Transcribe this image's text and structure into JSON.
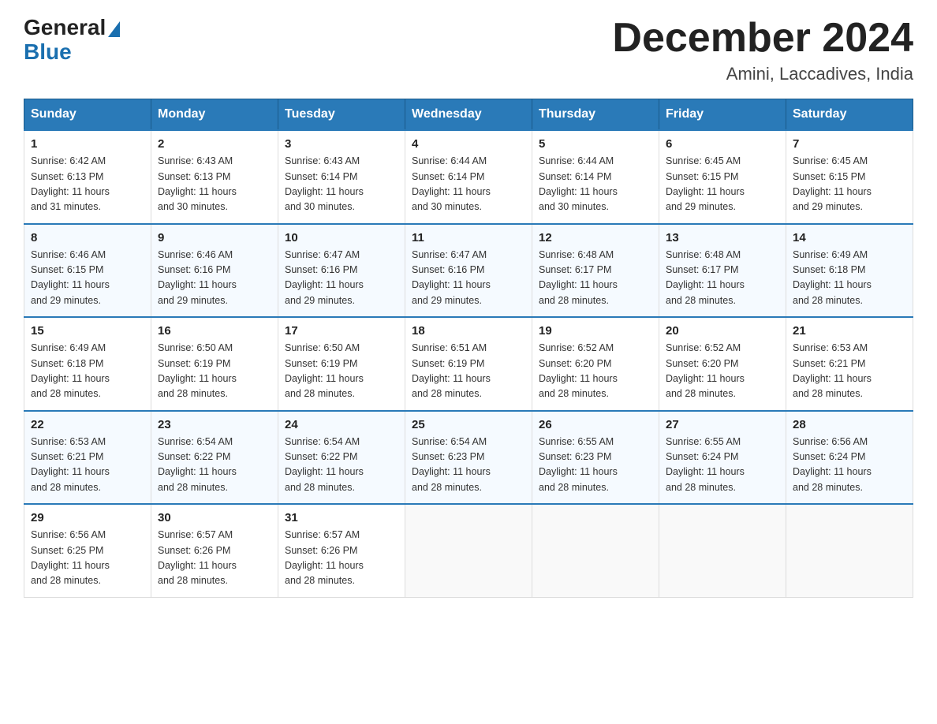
{
  "header": {
    "logo_line1": "General",
    "logo_line2": "Blue",
    "title": "December 2024",
    "subtitle": "Amini, Laccadives, India"
  },
  "days_of_week": [
    "Sunday",
    "Monday",
    "Tuesday",
    "Wednesday",
    "Thursday",
    "Friday",
    "Saturday"
  ],
  "weeks": [
    [
      {
        "day": "1",
        "sunrise": "6:42 AM",
        "sunset": "6:13 PM",
        "daylight": "11 hours and 31 minutes."
      },
      {
        "day": "2",
        "sunrise": "6:43 AM",
        "sunset": "6:13 PM",
        "daylight": "11 hours and 30 minutes."
      },
      {
        "day": "3",
        "sunrise": "6:43 AM",
        "sunset": "6:14 PM",
        "daylight": "11 hours and 30 minutes."
      },
      {
        "day": "4",
        "sunrise": "6:44 AM",
        "sunset": "6:14 PM",
        "daylight": "11 hours and 30 minutes."
      },
      {
        "day": "5",
        "sunrise": "6:44 AM",
        "sunset": "6:14 PM",
        "daylight": "11 hours and 30 minutes."
      },
      {
        "day": "6",
        "sunrise": "6:45 AM",
        "sunset": "6:15 PM",
        "daylight": "11 hours and 29 minutes."
      },
      {
        "day": "7",
        "sunrise": "6:45 AM",
        "sunset": "6:15 PM",
        "daylight": "11 hours and 29 minutes."
      }
    ],
    [
      {
        "day": "8",
        "sunrise": "6:46 AM",
        "sunset": "6:15 PM",
        "daylight": "11 hours and 29 minutes."
      },
      {
        "day": "9",
        "sunrise": "6:46 AM",
        "sunset": "6:16 PM",
        "daylight": "11 hours and 29 minutes."
      },
      {
        "day": "10",
        "sunrise": "6:47 AM",
        "sunset": "6:16 PM",
        "daylight": "11 hours and 29 minutes."
      },
      {
        "day": "11",
        "sunrise": "6:47 AM",
        "sunset": "6:16 PM",
        "daylight": "11 hours and 29 minutes."
      },
      {
        "day": "12",
        "sunrise": "6:48 AM",
        "sunset": "6:17 PM",
        "daylight": "11 hours and 28 minutes."
      },
      {
        "day": "13",
        "sunrise": "6:48 AM",
        "sunset": "6:17 PM",
        "daylight": "11 hours and 28 minutes."
      },
      {
        "day": "14",
        "sunrise": "6:49 AM",
        "sunset": "6:18 PM",
        "daylight": "11 hours and 28 minutes."
      }
    ],
    [
      {
        "day": "15",
        "sunrise": "6:49 AM",
        "sunset": "6:18 PM",
        "daylight": "11 hours and 28 minutes."
      },
      {
        "day": "16",
        "sunrise": "6:50 AM",
        "sunset": "6:19 PM",
        "daylight": "11 hours and 28 minutes."
      },
      {
        "day": "17",
        "sunrise": "6:50 AM",
        "sunset": "6:19 PM",
        "daylight": "11 hours and 28 minutes."
      },
      {
        "day": "18",
        "sunrise": "6:51 AM",
        "sunset": "6:19 PM",
        "daylight": "11 hours and 28 minutes."
      },
      {
        "day": "19",
        "sunrise": "6:52 AM",
        "sunset": "6:20 PM",
        "daylight": "11 hours and 28 minutes."
      },
      {
        "day": "20",
        "sunrise": "6:52 AM",
        "sunset": "6:20 PM",
        "daylight": "11 hours and 28 minutes."
      },
      {
        "day": "21",
        "sunrise": "6:53 AM",
        "sunset": "6:21 PM",
        "daylight": "11 hours and 28 minutes."
      }
    ],
    [
      {
        "day": "22",
        "sunrise": "6:53 AM",
        "sunset": "6:21 PM",
        "daylight": "11 hours and 28 minutes."
      },
      {
        "day": "23",
        "sunrise": "6:54 AM",
        "sunset": "6:22 PM",
        "daylight": "11 hours and 28 minutes."
      },
      {
        "day": "24",
        "sunrise": "6:54 AM",
        "sunset": "6:22 PM",
        "daylight": "11 hours and 28 minutes."
      },
      {
        "day": "25",
        "sunrise": "6:54 AM",
        "sunset": "6:23 PM",
        "daylight": "11 hours and 28 minutes."
      },
      {
        "day": "26",
        "sunrise": "6:55 AM",
        "sunset": "6:23 PM",
        "daylight": "11 hours and 28 minutes."
      },
      {
        "day": "27",
        "sunrise": "6:55 AM",
        "sunset": "6:24 PM",
        "daylight": "11 hours and 28 minutes."
      },
      {
        "day": "28",
        "sunrise": "6:56 AM",
        "sunset": "6:24 PM",
        "daylight": "11 hours and 28 minutes."
      }
    ],
    [
      {
        "day": "29",
        "sunrise": "6:56 AM",
        "sunset": "6:25 PM",
        "daylight": "11 hours and 28 minutes."
      },
      {
        "day": "30",
        "sunrise": "6:57 AM",
        "sunset": "6:26 PM",
        "daylight": "11 hours and 28 minutes."
      },
      {
        "day": "31",
        "sunrise": "6:57 AM",
        "sunset": "6:26 PM",
        "daylight": "11 hours and 28 minutes."
      },
      null,
      null,
      null,
      null
    ]
  ],
  "labels": {
    "sunrise": "Sunrise:",
    "sunset": "Sunset:",
    "daylight": "Daylight:"
  }
}
